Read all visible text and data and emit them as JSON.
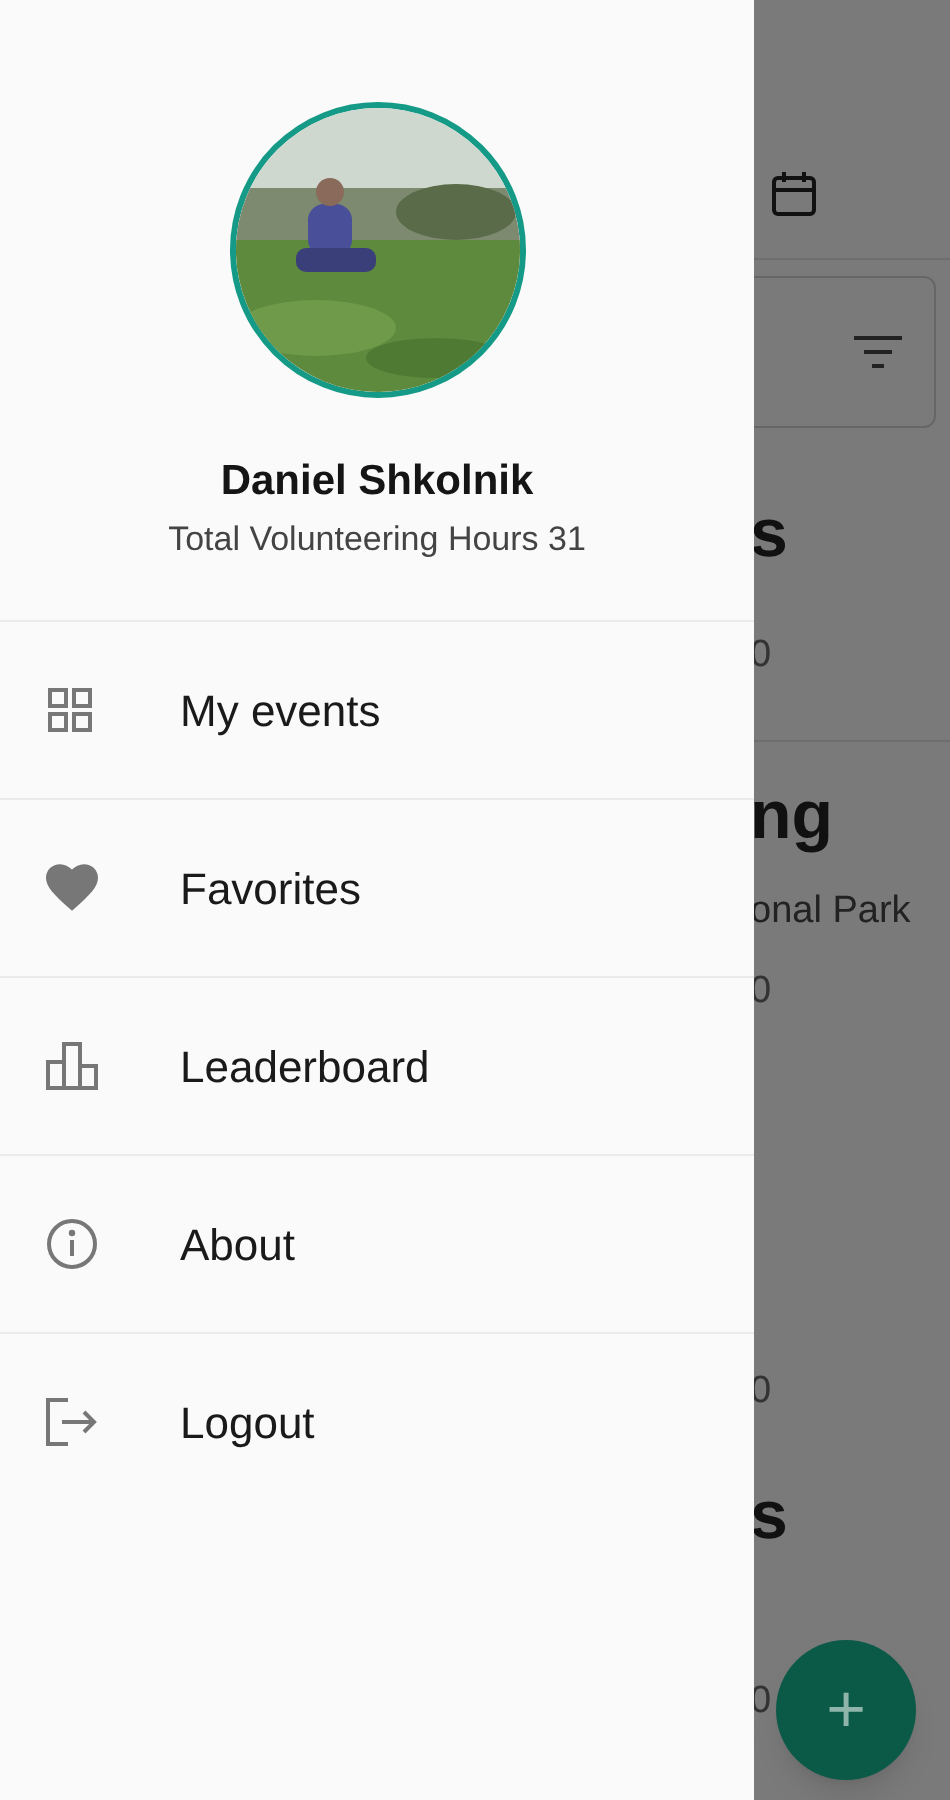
{
  "drawer": {
    "profile": {
      "name": "Daniel Shkolnik",
      "subtitle": "Total Volunteering Hours 31"
    },
    "menu": [
      {
        "kind": "grid",
        "label": "My events"
      },
      {
        "kind": "heart",
        "label": "Favorites"
      },
      {
        "kind": "podium",
        "label": "Leaderboard"
      },
      {
        "kind": "info",
        "label": "About"
      },
      {
        "kind": "logout",
        "label": "Logout"
      }
    ]
  },
  "background": {
    "fragments": [
      {
        "kind": "title",
        "text": "s"
      },
      {
        "kind": "meta",
        "text": "0"
      },
      {
        "kind": "title",
        "text": "ng"
      },
      {
        "kind": "subtitle",
        "text": "onal Park"
      },
      {
        "kind": "meta",
        "text": "0"
      },
      {
        "kind": "meta",
        "text": "0"
      },
      {
        "kind": "title",
        "text": "s"
      },
      {
        "kind": "meta",
        "text": "0"
      }
    ],
    "fab": "+"
  }
}
